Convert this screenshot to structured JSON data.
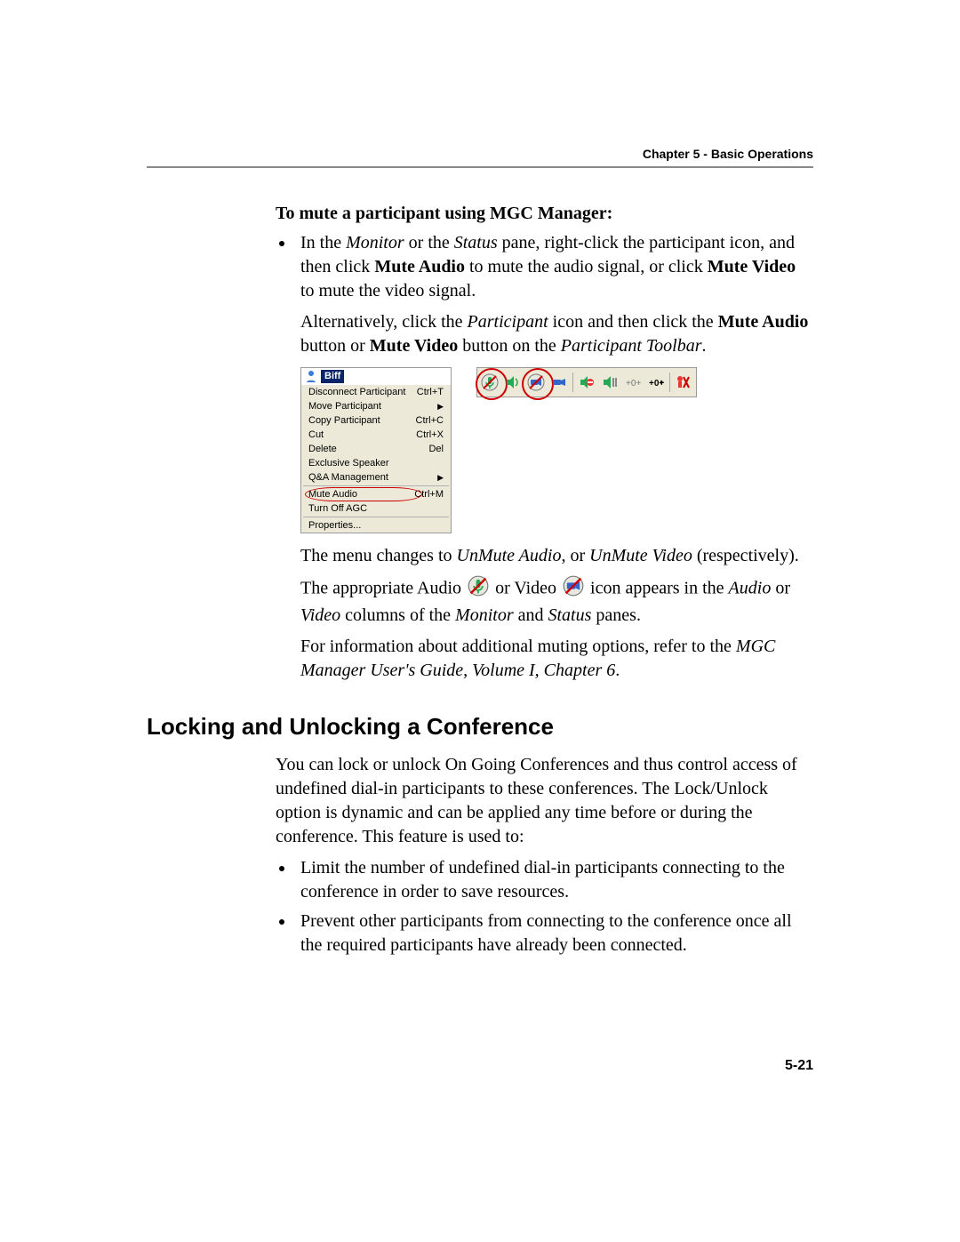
{
  "header": {
    "chapter": "Chapter 5 - Basic Operations"
  },
  "section1": {
    "title": "To mute a participant using MGC Manager:",
    "bullet1_parts": {
      "a": "In the ",
      "monitor": "Monitor",
      "b": " or the ",
      "status": "Status",
      "c": " pane, right-click the participant icon, and then click ",
      "mute_audio": "Mute Audio",
      "d": " to mute the audio signal, or click ",
      "mute_video": "Mute Video",
      "e": " to mute the video signal."
    },
    "para_alt": {
      "a": "Alternatively, click the ",
      "participant": "Participant",
      "b": " icon and then click the ",
      "mute_audio": "Mute Audio",
      "c": " button or ",
      "mute_video": "Mute Video",
      "d": " button on the ",
      "toolbar": "Participant Toolbar",
      "e": "."
    },
    "para_menu_change": {
      "a": "The menu changes to ",
      "unmute_audio": "UnMute Audio",
      "b": ", or ",
      "unmute_video": "UnMute Video",
      "c": " (respectively)."
    },
    "para_icon": {
      "a": "The appropriate Audio ",
      "b": " or Video ",
      "c": " icon appears in the ",
      "audio": "Audio",
      "d": " or ",
      "video": "Video",
      "e": " columns of the ",
      "monitor": "Monitor",
      "f": " and ",
      "status": "Status",
      "g": " panes."
    },
    "para_info": {
      "a": "For information about additional muting options, refer to the ",
      "guide": "MGC Manager User's Guide, Volume I, Chapter 6",
      "b": "."
    }
  },
  "context_menu": {
    "participant_name": "Biff",
    "items": [
      {
        "label": "Disconnect Participant",
        "shortcut": "Ctrl+T",
        "submenu": false
      },
      {
        "label": "Move Participant",
        "shortcut": "",
        "submenu": true
      },
      {
        "label": "Copy Participant",
        "shortcut": "Ctrl+C",
        "submenu": false
      },
      {
        "label": "Cut",
        "shortcut": "Ctrl+X",
        "submenu": false
      },
      {
        "label": "Delete",
        "shortcut": "Del",
        "submenu": false
      },
      {
        "label": "Exclusive Speaker",
        "shortcut": "",
        "submenu": false
      },
      {
        "label": "Q&A Management",
        "shortcut": "",
        "submenu": true
      }
    ],
    "highlight_item": {
      "label": "Mute Audio",
      "shortcut": "Ctrl+M"
    },
    "after_highlight": {
      "label": "Turn Off AGC",
      "shortcut": ""
    },
    "properties": {
      "label": "Properties..."
    }
  },
  "toolbar_icons": [
    "mute-audio-icon",
    "speaker-icon",
    "mute-video-icon",
    "camera-icon",
    "block-audio-icon",
    "suspend-video-icon",
    "agc-off-icon",
    "agc-on-icon",
    "remove-icon"
  ],
  "section2": {
    "heading": "Locking and Unlocking a Conference",
    "para1": "You can lock or unlock On Going Conferences and thus control access of undefined dial-in participants to these conferences. The Lock/Unlock option is dynamic and can be applied any time before or during the conference. This feature is used to:",
    "bullet1": "Limit the number of undefined dial-in participants connecting to the conference in order to save resources.",
    "bullet2": "Prevent other participants from connecting to the conference once all the required participants have already been connected."
  },
  "footer": {
    "page_number": "5-21"
  }
}
